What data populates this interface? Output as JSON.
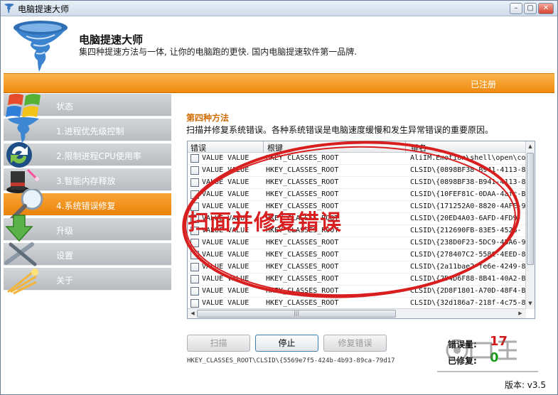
{
  "window": {
    "title": "电脑提速大师",
    "min_glyph": "–",
    "max_glyph": "▢",
    "close_glyph": "✕"
  },
  "header": {
    "app_name": "电脑提速大师",
    "slogan": "集四种提速方法与一体, 让你的电脑跑的更快. 国内电脑提速软件第一品牌."
  },
  "registration": "已注册",
  "sidebar": {
    "items": [
      {
        "label": "状态",
        "icon": "windows-logo-icon"
      },
      {
        "label": "1.进程优先级控制",
        "icon": "tornado-icon"
      },
      {
        "label": "2.限制进程CPU使用率",
        "icon": "refresh-arrows-icon"
      },
      {
        "label": "3.智能内存释放",
        "icon": "magic-hat-icon"
      },
      {
        "label": "4.系统错误修复",
        "icon": "magnifier-icon",
        "active": true
      },
      {
        "label": "升级",
        "icon": "download-arrow-icon"
      },
      {
        "label": "设置",
        "icon": "tools-icon"
      },
      {
        "label": "关于",
        "icon": "info-icon"
      }
    ]
  },
  "main": {
    "section_title": "第四种方法",
    "description": "扫描并修复系统错误。各种系统错误是电脑速度缓慢和发生异常错误的重要原因。",
    "columns": [
      "错误",
      "根键",
      "键名"
    ],
    "rows": [
      {
        "error": "VALUE VALUE",
        "root": "HKEY_CLASSES_ROOT",
        "key": "AliIM.Emotion\\shell\\open\\co"
      },
      {
        "error": "VALUE VALUE",
        "root": "HKEY_CLASSES_ROOT",
        "key": "CLSID\\{0898BF38-B941-4113-8"
      },
      {
        "error": "VALUE VALUE",
        "root": "HKEY_CLASSES_ROOT",
        "key": "CLSID\\{0898BF38-B941-4113-8"
      },
      {
        "error": "VALUE VALUE",
        "root": "HKEY_CLASSES_ROOT",
        "key": "CLSID\\{10FEF81C-0DAA-4afc-B"
      },
      {
        "error": "VALUE VALUE",
        "root": "HKEY_CLASSES_ROOT",
        "key": "CLSID\\{171252A0-8820-4AFE-9"
      },
      {
        "error": "VALUE VALUE",
        "root": "HKEY_CLASSES_ROOT",
        "key": "CLSID\\{20ED4A03-6AFD-4FD9-"
      },
      {
        "error": "VALUE VALUE",
        "root": "HKEY_CLASSES_ROOT",
        "key": "CLSID\\{212690FB-83E5-4526-"
      },
      {
        "error": "VALUE VALUE",
        "root": "HKEY_CLASSES_ROOT",
        "key": "CLSID\\{238D0F23-5DC9-45A6-9"
      },
      {
        "error": "VALUE VALUE",
        "root": "HKEY_CLASSES_ROOT",
        "key": "CLSID\\{278407C2-558C-4EED-8"
      },
      {
        "error": "VALUE VALUE",
        "root": "HKEY_CLASSES_ROOT",
        "key": "CLSID\\{2a11bae2-fe6e-4249-8"
      },
      {
        "error": "VALUE VALUE",
        "root": "HKEY_CLASSES_ROOT",
        "key": "CLSID\\{2D4D6F88-8B41-40A2-B"
      },
      {
        "error": "VALUE VALUE",
        "root": "HKEY_CLASSES_ROOT",
        "key": "CLSID\\{2D8F1801-A70D-48F4-B"
      },
      {
        "error": "VALUE VALUE",
        "root": "HKEY_CLASSES_ROOT",
        "key": "CLSID\\{32d186a7-218f-4c75-8"
      }
    ],
    "buttons": {
      "scan": "扫描",
      "stop": "停止",
      "fix": "修复错误"
    },
    "error_count_label": "错误量:",
    "error_count": "17",
    "fixed_label": "已修复:",
    "fixed_count": "0",
    "status_path": "HKEY_CLASSES_ROOT\\CLSID\\{5569e7f5-424b-4b93-89ca-79d17",
    "version": "版本: v3.5"
  },
  "annotation": {
    "text": "扫面并修复错误",
    "color": "#d81e1e"
  },
  "colors": {
    "accent": "#f08c12",
    "error": "#d21a1a",
    "ok": "#1a9b1a"
  }
}
